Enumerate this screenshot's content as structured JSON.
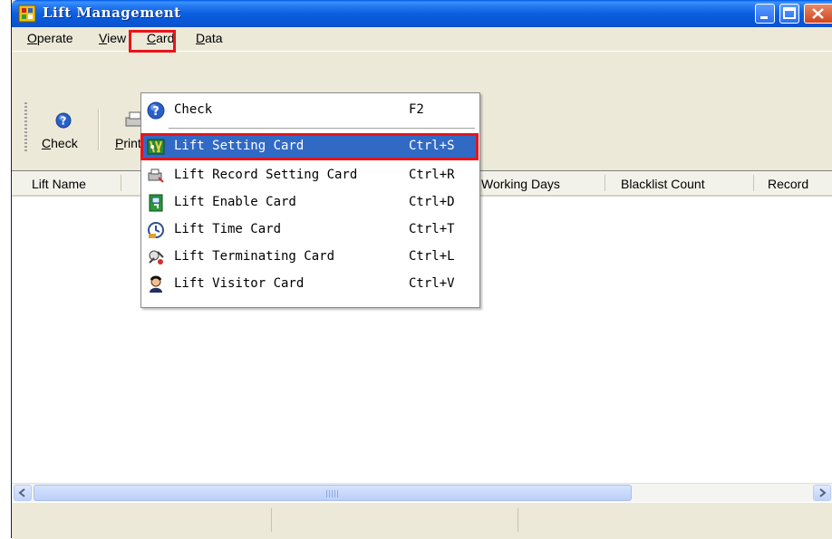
{
  "window": {
    "title": "Lift Management"
  },
  "menubar": {
    "items": [
      {
        "label": "Operate",
        "mnemonic": "O"
      },
      {
        "label": "View",
        "mnemonic": "V"
      },
      {
        "label": "Card",
        "mnemonic": "C"
      },
      {
        "label": "Data",
        "mnemonic": "D"
      }
    ]
  },
  "toolbar": {
    "check_label": "Check",
    "print_label": "Print"
  },
  "table": {
    "columns": [
      "Lift Name",
      "Working Days",
      "Blacklist Count",
      "Record"
    ]
  },
  "card_menu": {
    "items": [
      {
        "label": "Check",
        "shortcut": "F2",
        "icon": "check-help-icon"
      },
      {
        "label": "Lift Setting Card",
        "shortcut": "Ctrl+S",
        "icon": "setting-card-icon",
        "selected": true
      },
      {
        "label": "Lift Record Setting Card",
        "shortcut": "Ctrl+R",
        "icon": "record-card-icon"
      },
      {
        "label": "Lift Enable Card",
        "shortcut": "Ctrl+D",
        "icon": "enable-card-icon"
      },
      {
        "label": "Lift Time Card",
        "shortcut": "Ctrl+T",
        "icon": "time-card-icon"
      },
      {
        "label": "Lift Terminating Card",
        "shortcut": "Ctrl+L",
        "icon": "terminating-card-icon"
      },
      {
        "label": "Lift Visitor Card",
        "shortcut": "Ctrl+V",
        "icon": "visitor-card-icon"
      }
    ]
  },
  "colors": {
    "title_bar": "#0a57d6",
    "menu_selection": "#316ac5",
    "annotation_red": "#e8141b"
  }
}
